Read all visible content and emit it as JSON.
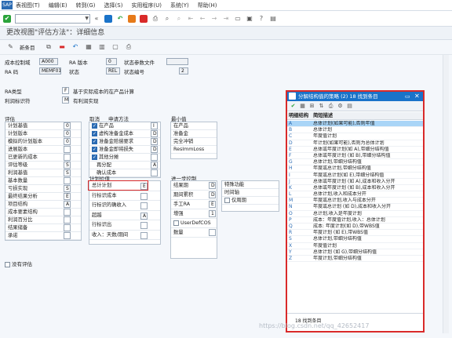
{
  "menu": {
    "items": [
      "表视图(T)",
      "编辑(E)",
      "转到(G)",
      "选择(S)",
      "实用程序(U)",
      "系统(Y)",
      "帮助(H)"
    ]
  },
  "toolbar": {
    "command_field": ""
  },
  "title": "更改视图\"评估方法\"：详细信息",
  "app_toolbar": {
    "new_entries": "新条目"
  },
  "header": {
    "cost_ctrl_label": "成本控制域",
    "cost_ctrl_value": "A000",
    "ra_version_label": "RA 版本",
    "ra_version_value": "0",
    "status_profile_label": "状态参数文件",
    "status_profile_value": "",
    "ra_key_label": "RA 码",
    "ra_key_value": "MEMF01",
    "status_label": "状态",
    "status_value": "REL",
    "status_no_label": "状态编号",
    "status_no_value": "2"
  },
  "ra_type": {
    "label": "RA类型",
    "value": "F",
    "desc": "基于实际成本的在产品计算"
  },
  "profit_ind": {
    "label": "利润标识符",
    "value": "M",
    "desc": "有利润实现"
  },
  "valuation": {
    "title": "评估",
    "rows": [
      {
        "label": "计划基值",
        "value": "0"
      },
      {
        "label": "计划版本",
        "value": "0"
      },
      {
        "label": "模拟的计划版本",
        "value": "0"
      },
      {
        "label": "进展版本",
        "value": ""
      },
      {
        "label": "已更新的成本",
        "value": ""
      },
      {
        "label": "评估等级",
        "value": "S"
      },
      {
        "label": "利润基值",
        "value": "S"
      },
      {
        "label": "基本数量",
        "value": ""
      },
      {
        "label": "亏损实现",
        "value": "S"
      },
      {
        "label": "最终结果分析",
        "value": "E"
      },
      {
        "label": "项目结构",
        "value": "A"
      },
      {
        "label": "成本要素结构",
        "value": ""
      },
      {
        "label": "利润百分比",
        "value": ""
      },
      {
        "label": "结果储备",
        "value": ""
      },
      {
        "label": "承诺",
        "value": ""
      }
    ],
    "no_valuation": "没有评估"
  },
  "cancel_apply": {
    "title": "取消",
    "title2": "申请方法",
    "rows": [
      {
        "label": "在产品",
        "value": "I",
        "checked": true
      },
      {
        "label": "虚构准备金成本",
        "value": "D",
        "checked": true
      },
      {
        "label": "准备金赔偿要求",
        "value": "D",
        "checked": true
      },
      {
        "label": "准备金即将损失",
        "value": "D",
        "checked": true
      },
      {
        "label": "其他分摊",
        "value": "",
        "checked": true
      },
      {
        "label": "再分配",
        "value": "A",
        "checked": false
      },
      {
        "label": "确认成本",
        "value": "",
        "checked": false
      }
    ]
  },
  "minimum": {
    "title": "最小值",
    "rows": [
      "在产品",
      "准备金",
      "完全冲销",
      "ResImmLoss"
    ]
  },
  "plan_value": {
    "title": "计划价值",
    "rows": [
      {
        "label": "总计计划",
        "value": "E"
      },
      {
        "label": "行标识成本",
        "value": ""
      },
      {
        "label": "行标识的确收入",
        "value": ""
      },
      {
        "label": "超越",
        "value": "A"
      },
      {
        "label": "行标识出",
        "value": ""
      },
      {
        "label": "收入：天数/期间",
        "value": ""
      }
    ]
  },
  "further": {
    "title": "进一步控制",
    "rows": [
      {
        "label": "结果期",
        "value": "D"
      },
      {
        "label": "期间累积",
        "value": "D"
      },
      {
        "label": "手工RA",
        "value": "E"
      },
      {
        "label": "增强",
        "value": "1"
      },
      {
        "label": "UserDefCOS",
        "value": ""
      },
      {
        "label": "数量",
        "value": ""
      }
    ],
    "right": [
      "特殊功能",
      "时间轴",
      "仅周期"
    ]
  },
  "popup": {
    "title": "分解结构值的策略 (2)  18 找到条目",
    "header_c1": "明细结构",
    "header_c2": "简短描述",
    "rows": [
      {
        "k": "A",
        "v": "总体计划(如果可能),否则年值"
      },
      {
        "k": "B",
        "v": "总体计划"
      },
      {
        "k": "C",
        "v": "年度值计划"
      },
      {
        "k": "D",
        "v": "年计划(如果可能),否则为总体计划"
      },
      {
        "k": "E",
        "v": "总体或年度计划(如 A),带细分结构值"
      },
      {
        "k": "F",
        "v": "总体或年度计划 (如 B),带细分结构值"
      },
      {
        "k": "G",
        "v": "总体计划,带细分结构值"
      },
      {
        "k": "H",
        "v": "年度或总计划,带细分结构值"
      },
      {
        "k": "I",
        "v": "年度或总计划(如 E),带细分结构值"
      },
      {
        "k": "J",
        "v": "总体或年度计划 (如 A),成本和收入分开"
      },
      {
        "k": "K",
        "v": "总体或年度计划 (如 B),成本和收入分开"
      },
      {
        "k": "L",
        "v": "总体计划,收入和成本分开"
      },
      {
        "k": "M",
        "v": "年度或总计划,收入与成本分开"
      },
      {
        "k": "N",
        "v": "年度或总计划 (如 D),成本和收入分开"
      },
      {
        "k": "O",
        "v": "总计划,收入是年度计划"
      },
      {
        "k": "P",
        "v": "成本：年度值计划,收入：总体计划"
      },
      {
        "k": "Q",
        "v": "成本: 年度计划(如 D),带WBS值"
      },
      {
        "k": "R",
        "v": "年度计划 (如 E),带WBS值"
      },
      {
        "k": "S",
        "v": "总体计划,带细分结构值"
      },
      {
        "k": "X",
        "v": "年度值计划"
      },
      {
        "k": "Y",
        "v": "总体计划 (如 G),带细分结构值"
      },
      {
        "k": "Z",
        "v": "年度计划,带细分结构值"
      }
    ],
    "footer": "18 找到条目"
  },
  "watermark": "https://blog.csdn.net/qq_42652417"
}
